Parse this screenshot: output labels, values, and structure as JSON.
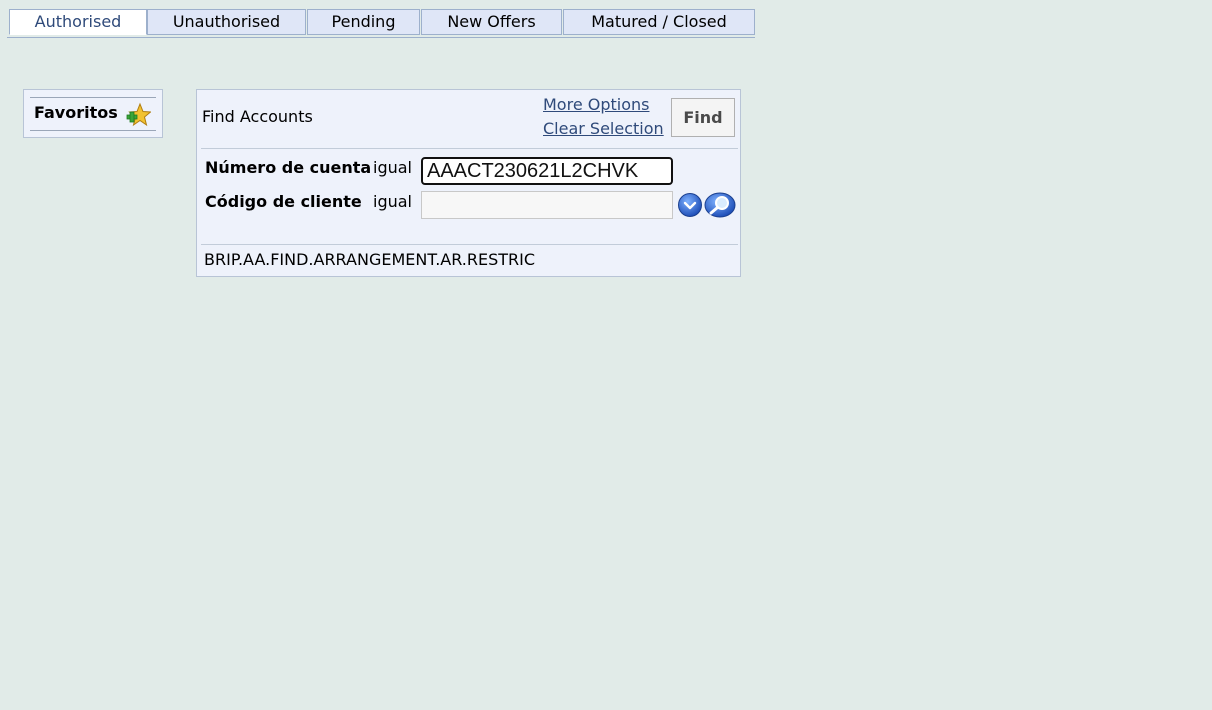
{
  "tabs": [
    {
      "label": "Authorised",
      "active": true
    },
    {
      "label": "Unauthorised",
      "active": false
    },
    {
      "label": "Pending",
      "active": false
    },
    {
      "label": "New Offers",
      "active": false
    },
    {
      "label": "Matured / Closed",
      "active": false
    }
  ],
  "favorites": {
    "label": "Favoritos",
    "icon": "add-favorite-star-icon"
  },
  "find_panel": {
    "title": "Find Accounts",
    "more_options": "More Options",
    "clear_selection": "Clear Selection",
    "find_button": "Find",
    "fields": [
      {
        "label": "Número de cuenta",
        "operator": "igual",
        "value": "AAACT230621L2CHVK",
        "placeholder": ""
      },
      {
        "label": "Código de cliente",
        "operator": "igual",
        "value": "",
        "placeholder": ""
      }
    ],
    "dropdown_icon": "chevron-down-icon",
    "search_icon": "magnifier-icon",
    "enquiry_name": "BRIP.AA.FIND.ARRANGEMENT.AR.RESTRIC"
  },
  "colors": {
    "background": "#e1ebe8",
    "panel": "#eef2fb",
    "tab_inactive": "#dfe6f7",
    "link": "#2f4a7a",
    "icon_blue": "#2f6fd0",
    "star_gold": "#e8b020",
    "plus_green": "#3aa53a"
  }
}
